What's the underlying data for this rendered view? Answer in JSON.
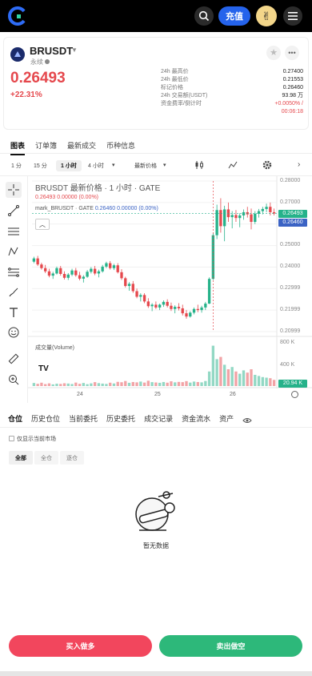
{
  "topbar": {
    "deposit_label": "充值"
  },
  "market": {
    "symbol": "BRUSDT",
    "contract_type": "永续",
    "last_price": "0.26493",
    "change_pct": "+22.31%",
    "stats": [
      {
        "label": "24h 最高价",
        "value": "0.27400"
      },
      {
        "label": "24h 最低价",
        "value": "0.21553"
      },
      {
        "label": "标记价格",
        "value": "0.26460"
      },
      {
        "label": "24h 交易额(USDT)",
        "value": "93.98 万"
      },
      {
        "label": "资金费率/倒计时",
        "value": "+0.0050% /"
      },
      {
        "label": "",
        "value": "00:06:18"
      }
    ]
  },
  "chart_tabs": [
    "图表",
    "订单簿",
    "最新成交",
    "币种信息"
  ],
  "intervals": [
    "1 分",
    "15 分",
    "1 小时",
    "4 小时",
    "最新价格"
  ],
  "chart_legend": {
    "title": "BRUSDT 最新价格 · 1 小时 · GATE",
    "price_line": "0.26493  0.00000 (0.00%)",
    "mark_label": "mark_BRUSDT · GATE",
    "mark_values": "0.26460  0.00000 (0.00%)"
  },
  "volume_label": "成交量(Volume)",
  "price_axis": [
    "0.28000",
    "0.27000",
    "0.26000",
    "0.25000",
    "0.24000",
    "0.22999",
    "0.21999",
    "0.20999"
  ],
  "price_tags": {
    "last": "0.26493",
    "mark": "0.26460",
    "volume": "20.94 K"
  },
  "volume_axis": [
    "800 K",
    "400 K"
  ],
  "time_axis": [
    "24",
    "25",
    "26"
  ],
  "colors": {
    "up": "#26b28a",
    "down": "#e5484d",
    "mark": "#3b63c4",
    "accent": "#2563eb"
  },
  "chart_data": {
    "type": "candlestick",
    "title": "BRUSDT 最新价格 · 1 小时 · GATE",
    "ylim": [
      0.20999,
      0.28
    ],
    "x_ticks": [
      "24",
      "25",
      "26"
    ],
    "series": [
      {
        "name": "BRUSDT",
        "candles": [
          [
            0.2425,
            0.2448,
            0.2418,
            0.244
          ],
          [
            0.244,
            0.2452,
            0.2405,
            0.2412
          ],
          [
            0.2412,
            0.242,
            0.2388,
            0.2395
          ],
          [
            0.2395,
            0.241,
            0.2372,
            0.238
          ],
          [
            0.238,
            0.2392,
            0.2352,
            0.236
          ],
          [
            0.236,
            0.2378,
            0.2345,
            0.237
          ],
          [
            0.237,
            0.2402,
            0.2365,
            0.2395
          ],
          [
            0.2395,
            0.2405,
            0.236,
            0.2368
          ],
          [
            0.2368,
            0.238,
            0.2342,
            0.235
          ],
          [
            0.235,
            0.2372,
            0.234,
            0.2365
          ],
          [
            0.2365,
            0.2392,
            0.2358,
            0.2384
          ],
          [
            0.2384,
            0.2396,
            0.2355,
            0.2362
          ],
          [
            0.2362,
            0.2378,
            0.2338,
            0.2346
          ],
          [
            0.2346,
            0.2362,
            0.2328,
            0.2355
          ],
          [
            0.2355,
            0.2386,
            0.235,
            0.2378
          ],
          [
            0.2378,
            0.24,
            0.237,
            0.2392
          ],
          [
            0.2392,
            0.2405,
            0.2362,
            0.237
          ],
          [
            0.237,
            0.2388,
            0.2352,
            0.238
          ],
          [
            0.238,
            0.241,
            0.2374,
            0.2402
          ],
          [
            0.2402,
            0.2425,
            0.2395,
            0.2418
          ],
          [
            0.2418,
            0.2428,
            0.2388,
            0.2395
          ],
          [
            0.2395,
            0.2415,
            0.2386,
            0.2408
          ],
          [
            0.2408,
            0.2418,
            0.237,
            0.2376
          ],
          [
            0.2376,
            0.239,
            0.234,
            0.2348
          ],
          [
            0.2348,
            0.2355,
            0.2305,
            0.2312
          ],
          [
            0.2312,
            0.233,
            0.229,
            0.2322
          ],
          [
            0.2322,
            0.2335,
            0.228,
            0.2288
          ],
          [
            0.2288,
            0.23,
            0.2255,
            0.2262
          ],
          [
            0.2262,
            0.2278,
            0.224,
            0.227
          ],
          [
            0.227,
            0.2278,
            0.2232,
            0.224
          ],
          [
            0.224,
            0.2255,
            0.221,
            0.2218
          ],
          [
            0.2218,
            0.2232,
            0.2195,
            0.2225
          ],
          [
            0.2225,
            0.224,
            0.2205,
            0.2212
          ],
          [
            0.2212,
            0.223,
            0.22,
            0.2225
          ],
          [
            0.2225,
            0.2245,
            0.2215,
            0.2238
          ],
          [
            0.2238,
            0.225,
            0.2212,
            0.222
          ],
          [
            0.222,
            0.2235,
            0.2196,
            0.2205
          ],
          [
            0.2205,
            0.2222,
            0.2185,
            0.2215
          ],
          [
            0.2215,
            0.2232,
            0.2198,
            0.2208
          ],
          [
            0.2208,
            0.2225,
            0.2175,
            0.2185
          ],
          [
            0.2185,
            0.22,
            0.216,
            0.217
          ],
          [
            0.217,
            0.2195,
            0.2165,
            0.2188
          ],
          [
            0.2188,
            0.2212,
            0.218,
            0.2205
          ],
          [
            0.2205,
            0.2225,
            0.219,
            0.22
          ],
          [
            0.22,
            0.222,
            0.2188,
            0.2212
          ],
          [
            0.2212,
            0.2238,
            0.22,
            0.223
          ],
          [
            0.223,
            0.2352,
            0.2228,
            0.2345
          ],
          [
            0.2345,
            0.256,
            0.234,
            0.2548
          ],
          [
            0.2548,
            0.269,
            0.253,
            0.2665
          ],
          [
            0.2665,
            0.272,
            0.256,
            0.259
          ],
          [
            0.259,
            0.2685,
            0.252,
            0.2668
          ],
          [
            0.2668,
            0.27,
            0.261,
            0.2632
          ],
          [
            0.2632,
            0.266,
            0.258,
            0.2642
          ],
          [
            0.2642,
            0.2665,
            0.261,
            0.2628
          ],
          [
            0.2628,
            0.265,
            0.2585,
            0.264
          ],
          [
            0.264,
            0.2668,
            0.262,
            0.2655
          ],
          [
            0.2655,
            0.268,
            0.263,
            0.2645
          ],
          [
            0.2645,
            0.2672,
            0.2575,
            0.261
          ],
          [
            0.261,
            0.266,
            0.26,
            0.2648
          ],
          [
            0.2648,
            0.267,
            0.263,
            0.266
          ],
          [
            0.266,
            0.268,
            0.2645,
            0.267
          ],
          [
            0.267,
            0.2695,
            0.2655,
            0.268
          ],
          [
            0.268,
            0.27,
            0.264,
            0.2655
          ],
          [
            0.2655,
            0.2672,
            0.264,
            0.2649
          ]
        ]
      },
      {
        "name": "Volume",
        "values": [
          55,
          40,
          60,
          35,
          48,
          30,
          42,
          38,
          50,
          45,
          36,
          62,
          40,
          55,
          33,
          48,
          70,
          52,
          44,
          38,
          60,
          46,
          75,
          68,
          90,
          58,
          72,
          66,
          80,
          62,
          95,
          70,
          64,
          58,
          72,
          60,
          85,
          66,
          74,
          70,
          88,
          62,
          80,
          72,
          66,
          90,
          260,
          720,
          480,
          520,
          380,
          300,
          340,
          260,
          220,
          280,
          240,
          300,
          200,
          180,
          160,
          150,
          140,
          110
        ]
      }
    ]
  },
  "position_tabs": [
    "仓位",
    "历史仓位",
    "当前委托",
    "历史委托",
    "成交记录",
    "资金流水",
    "资产"
  ],
  "position_filter": {
    "checkbox_label": "仅显示当前市场",
    "options": [
      "全部",
      "全仓",
      "逐仓"
    ]
  },
  "empty_state": "暂无数据",
  "actions": {
    "buy_label": "买入做多",
    "sell_label": "卖出做空"
  }
}
